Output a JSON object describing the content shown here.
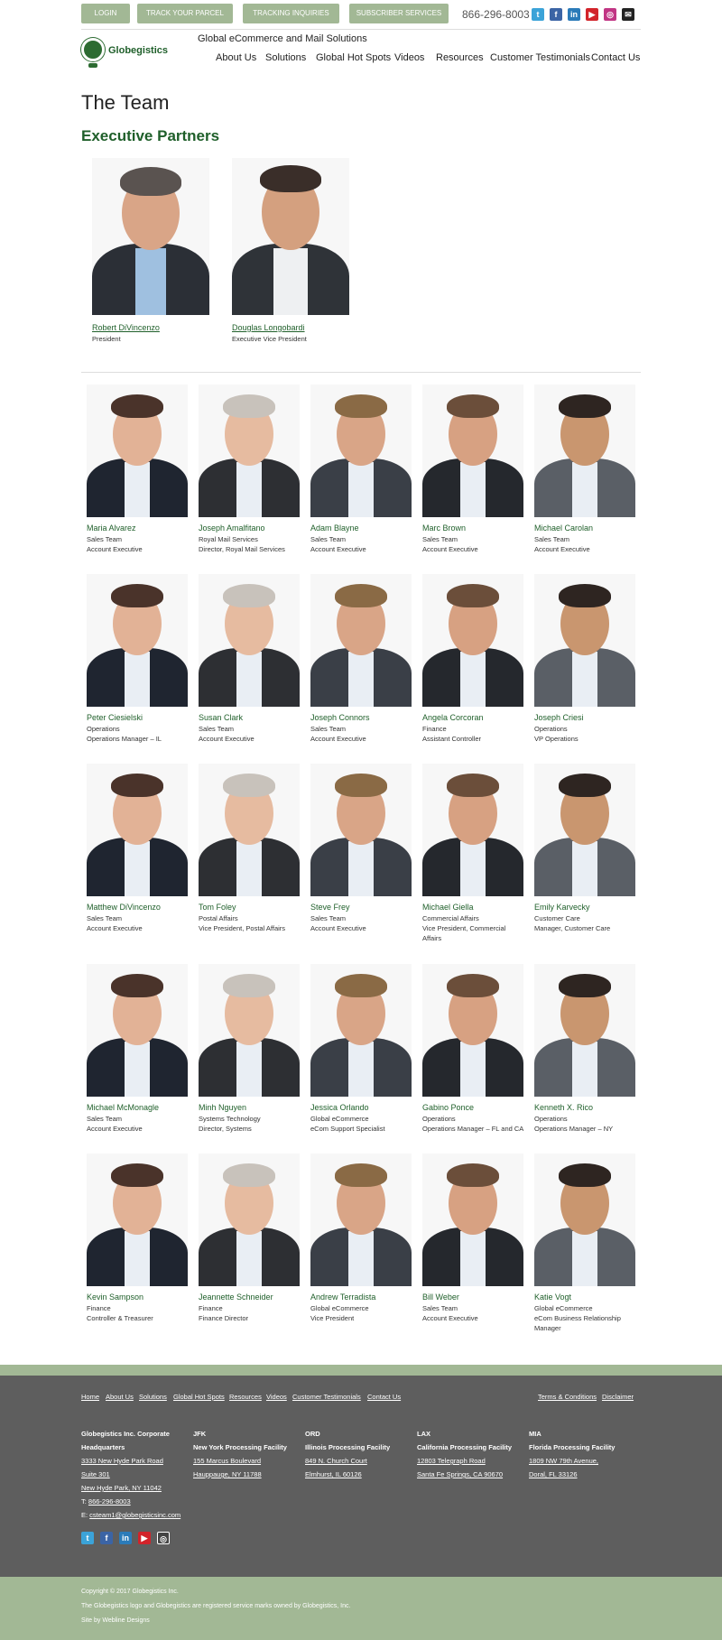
{
  "topbar": {
    "buttons": [
      "LOGIN",
      "TRACK YOUR PARCEL",
      "TRACKING INQUIRIES",
      "SUBSCRIBER SERVICES"
    ],
    "phone": "866-296-8003",
    "social_icons": [
      "twitter-icon",
      "facebook-icon",
      "linkedin-icon",
      "youtube-icon",
      "instagram-icon",
      "email-icon"
    ]
  },
  "header": {
    "logo_text": "Globegistics",
    "tagline": "Global eCommerce and Mail Solutions",
    "nav": [
      "About Us",
      "Solutions",
      "Global Hot Spots",
      "Videos",
      "Resources",
      "Customer Testimonials",
      "Contact Us"
    ]
  },
  "page": {
    "title": "The Team",
    "subtitle": "Executive Partners"
  },
  "partners": [
    {
      "name": "Robert DiVincenzo",
      "role": "President"
    },
    {
      "name": "Douglas Longobardi",
      "role": "Executive Vice President"
    }
  ],
  "team": [
    {
      "name": "Maria Alvarez",
      "line1": "Sales Team",
      "line2": "Account Executive"
    },
    {
      "name": "Joseph Amalfitano",
      "line1": "Royal Mail Services",
      "line2": "Director, Royal Mail Services"
    },
    {
      "name": "Adam Blayne",
      "line1": "Sales Team",
      "line2": "Account Executive"
    },
    {
      "name": "Marc Brown",
      "line1": "Sales Team",
      "line2": "Account Executive"
    },
    {
      "name": "Michael Carolan",
      "line1": "Sales Team",
      "line2": "Account Executive"
    },
    {
      "name": "Peter Ciesielski",
      "line1": "Operations",
      "line2": "Operations Manager – IL"
    },
    {
      "name": "Susan Clark",
      "line1": "Sales Team",
      "line2": "Account Executive"
    },
    {
      "name": "Joseph Connors",
      "line1": "Sales Team",
      "line2": "Account Executive"
    },
    {
      "name": "Angela Corcoran",
      "line1": "Finance",
      "line2": "Assistant Controller"
    },
    {
      "name": "Joseph Criesi",
      "line1": "Operations",
      "line2": "VP Operations"
    },
    {
      "name": "Matthew DiVincenzo",
      "line1": "Sales Team",
      "line2": "Account Executive"
    },
    {
      "name": "Tom Foley",
      "line1": "Postal Affairs",
      "line2": "Vice President, Postal Affairs"
    },
    {
      "name": "Steve Frey",
      "line1": "Sales Team",
      "line2": "Account Executive"
    },
    {
      "name": "Michael Giella",
      "line1": "Commercial Affairs",
      "line2": "Vice President, Commercial",
      "line3": "Affairs"
    },
    {
      "name": "Emily Karvecky",
      "line1": "Customer Care",
      "line2": "Manager, Customer Care"
    },
    {
      "name": "Michael McMonagle",
      "line1": "Sales Team",
      "line2": "Account Executive"
    },
    {
      "name": "Minh Nguyen",
      "line1": "Systems Technology",
      "line2": "Director, Systems"
    },
    {
      "name": "Jessica Orlando",
      "line1": "Global eCommerce",
      "line2": "eCom Support Specialist"
    },
    {
      "name": "Gabino Ponce",
      "line1": "Operations",
      "line2": "Operations Manager – FL and CA"
    },
    {
      "name": "Kenneth X. Rico",
      "line1": "Operations",
      "line2": "Operations Manager – NY"
    },
    {
      "name": "Kevin Sampson",
      "line1": "Finance",
      "line2": "Controller & Treasurer"
    },
    {
      "name": "Jeannette Schneider",
      "line1": "Finance",
      "line2": "Finance Director"
    },
    {
      "name": "Andrew Terradista",
      "line1": "Global eCommerce",
      "line2": "Vice President"
    },
    {
      "name": "Bill Weber",
      "line1": "Sales Team",
      "line2": "Account Executive"
    },
    {
      "name": "Katie Vogt",
      "line1": "Global eCommerce",
      "line2": "eCom Business Relationship",
      "line3": "Manager"
    }
  ],
  "footer": {
    "nav": [
      "Home",
      "About Us",
      "Solutions",
      "Global Hot Spots",
      "Resources",
      "Videos",
      "Customer Testimonials",
      "Contact Us"
    ],
    "legal": [
      "Terms & Conditions",
      "Disclaimer"
    ],
    "hq": {
      "title1": "Globegistics Inc. Corporate",
      "title2": "Headquarters",
      "addr1": "3333 New Hyde Park Road",
      "addr2": "Suite 301",
      "addr3": "New Hyde Park, NY 11042",
      "phone_label": "T: ",
      "phone": "866-296-8003",
      "email_label": "E: ",
      "email": "csteam1@globegisticsinc.com"
    },
    "facilities": [
      {
        "code": "JFK",
        "name": "New York Processing Facility",
        "addr1": "155 Marcus Boulevard",
        "addr2": "Hauppauge, NY 11788"
      },
      {
        "code": "ORD",
        "name": "Illinois Processing Facility",
        "addr1": "849 N. Church Court",
        "addr2": "Elmhurst, IL  60126"
      },
      {
        "code": "LAX",
        "name": "California Processing Facility",
        "addr1": "12803 Telegraph Road",
        "addr2": "Santa Fe Springs, CA  90670"
      },
      {
        "code": "MIA",
        "name": "Florida Processing Facility",
        "addr1": "1809 NW 79th Avenue,",
        "addr2": "Doral, FL  33126"
      }
    ],
    "copyright": "Copyright © 2017 Globegistics Inc.",
    "trademark": "The Globegistics logo and Globegistics are registered service marks owned by Globegistics, Inc.",
    "credit": "Site by Webline Designs"
  },
  "colors": {
    "brand_green": "#1f5f2a",
    "sage": "#a2b895",
    "footer_gray": "#5e5e5e"
  }
}
